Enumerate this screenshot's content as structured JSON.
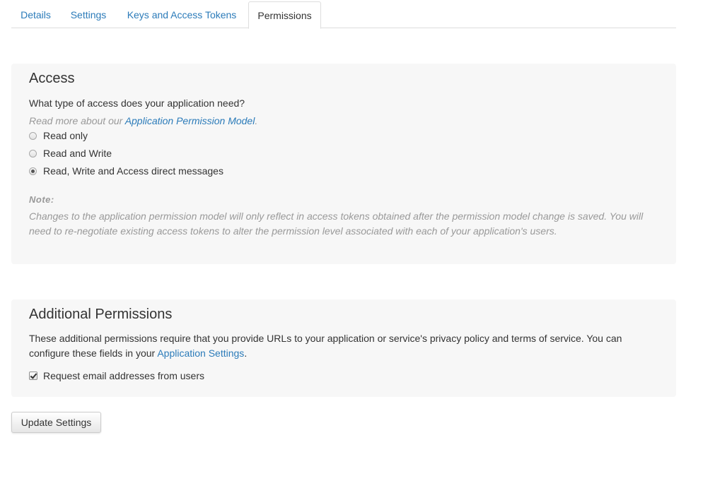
{
  "tabs": [
    {
      "label": "Details",
      "active": false
    },
    {
      "label": "Settings",
      "active": false
    },
    {
      "label": "Keys and Access Tokens",
      "active": false
    },
    {
      "label": "Permissions",
      "active": true
    }
  ],
  "access": {
    "title": "Access",
    "question": "What type of access does your application need?",
    "read_more_prefix": "Read more about our ",
    "read_more_link": "Application Permission Model",
    "read_more_suffix": ".",
    "options": [
      {
        "label": "Read only",
        "checked": false
      },
      {
        "label": "Read and Write",
        "checked": false
      },
      {
        "label": "Read, Write and Access direct messages",
        "checked": true
      }
    ],
    "note_label": "Note:",
    "note_text": "Changes to the application permission model will only reflect in access tokens obtained after the permission model change is saved. You will need to re-negotiate existing access tokens to alter the permission level associated with each of your application's users."
  },
  "additional": {
    "title": "Additional Permissions",
    "description_prefix": "These additional permissions require that you provide URLs to your application or service's privacy policy and terms of service. You can configure these fields in your ",
    "description_link": "Application Settings",
    "description_suffix": ".",
    "checkbox_label": "Request email addresses from users",
    "checkbox_checked": true
  },
  "update_button_label": "Update Settings",
  "colors": {
    "link": "#2b7bb9",
    "panel_background": "#f7f7f7",
    "muted_text": "#999999"
  }
}
